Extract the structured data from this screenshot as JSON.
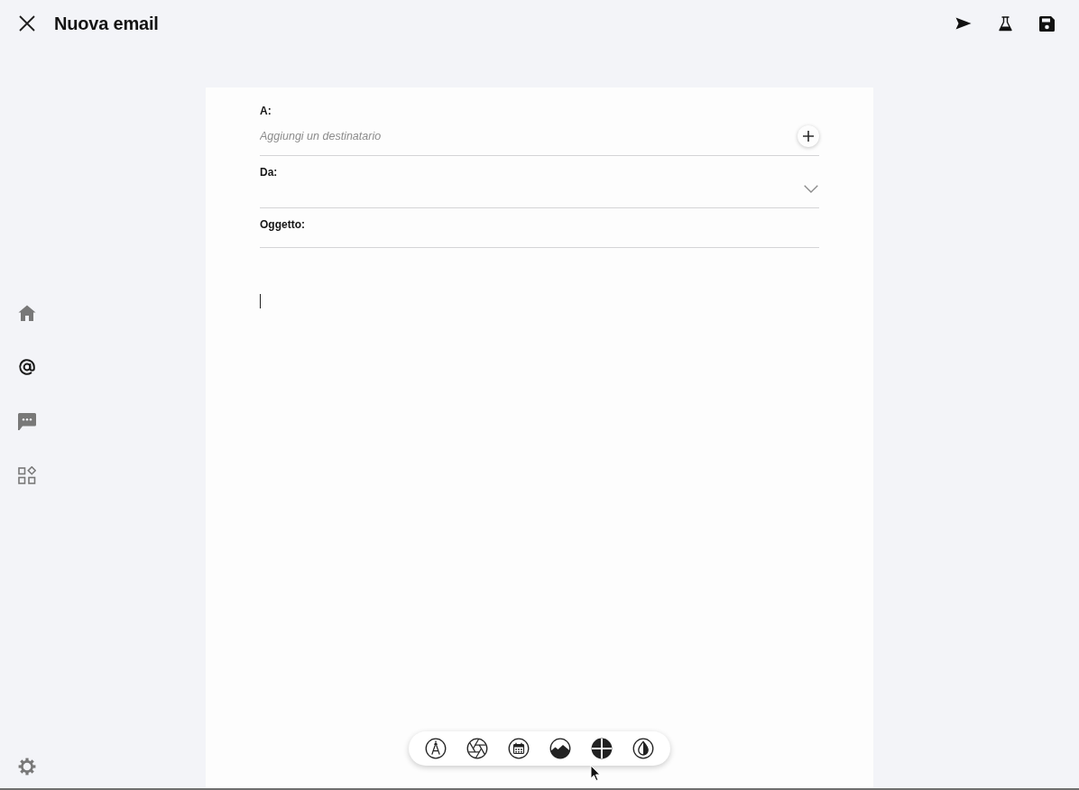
{
  "header": {
    "title": "Nuova email"
  },
  "sidebar": {
    "items": [
      {
        "selected": false
      },
      {
        "selected": true
      },
      {
        "selected": false
      },
      {
        "selected": false
      }
    ]
  },
  "compose": {
    "fields": [
      {
        "kind": "recipients",
        "label": "A:",
        "placeholder": "Aggiungi un destinatario"
      },
      {
        "kind": "select",
        "label": "Da:"
      },
      {
        "kind": "text",
        "label": "Oggetto:"
      }
    ]
  }
}
